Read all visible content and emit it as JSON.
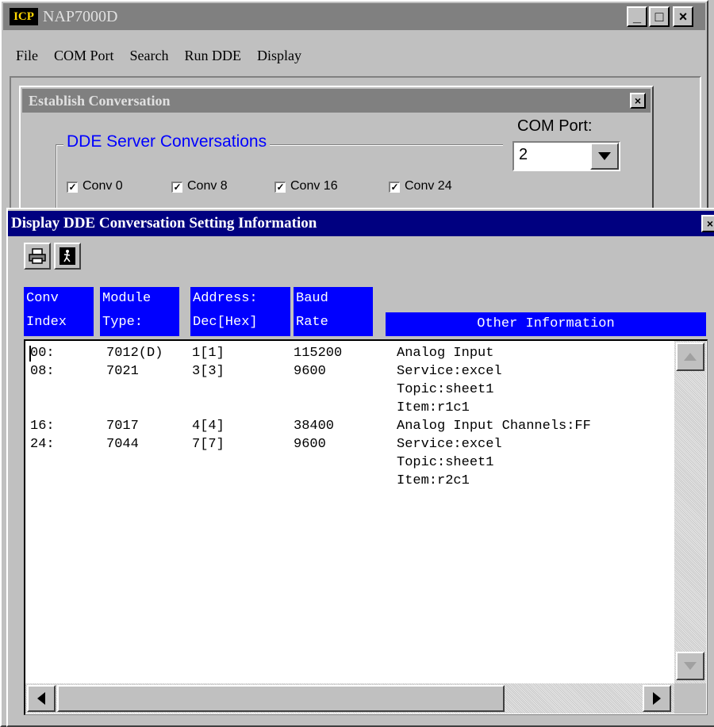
{
  "main_window": {
    "logo_text": "ICP",
    "title": "NAP7000D",
    "caption_buttons": [
      "_",
      "□",
      "×"
    ],
    "menu": [
      "File",
      "COM Port",
      "Search",
      "Run DDE",
      "Display"
    ]
  },
  "establish_dialog": {
    "title": "Establish Conversation",
    "close_label": "×",
    "group_title": "DDE Server Conversations",
    "com_port_label": "COM Port:",
    "com_port_value": "2",
    "checkboxes": [
      {
        "label": "Conv 0",
        "checked": true
      },
      {
        "label": "Conv 8",
        "checked": true
      },
      {
        "label": "Conv 16",
        "checked": true
      },
      {
        "label": "Conv 24",
        "checked": true
      }
    ]
  },
  "display_window": {
    "title": "Display DDE Conversation Setting Information",
    "close_label": "×",
    "toolbar": {
      "print_icon": "printer-icon",
      "exit_icon": "exit-door-icon"
    },
    "headers": {
      "conv_index": [
        "Conv",
        "Index"
      ],
      "module_type": [
        "Module",
        "Type:"
      ],
      "address": [
        "Address:",
        "Dec[Hex]"
      ],
      "baud_rate": [
        "Baud",
        "Rate"
      ],
      "other": "Other Information"
    },
    "rows": [
      {
        "conv": "00:",
        "module": "7012(D)",
        "address": "1[1]",
        "baud": "115200",
        "info": [
          "Analog Input"
        ]
      },
      {
        "conv": "08:",
        "module": "7021",
        "address": "3[3]",
        "baud": "9600",
        "info": [
          "Service:excel",
          "Topic:sheet1",
          "Item:r1c1"
        ]
      },
      {
        "conv": "16:",
        "module": "7017",
        "address": "4[4]",
        "baud": "38400",
        "info": [
          "Analog Input Channels:FF"
        ]
      },
      {
        "conv": "24:",
        "module": "7044",
        "address": "7[7]",
        "baud": "9600",
        "info": [
          "Service:excel",
          "Topic:sheet1",
          "Item:r2c1"
        ]
      }
    ]
  },
  "colors": {
    "titlebar_active": "#000080",
    "titlebar_inactive": "#808080",
    "header_blue": "#0000ff",
    "group_title_blue": "#0000ff",
    "face": "#c0c0c0"
  }
}
